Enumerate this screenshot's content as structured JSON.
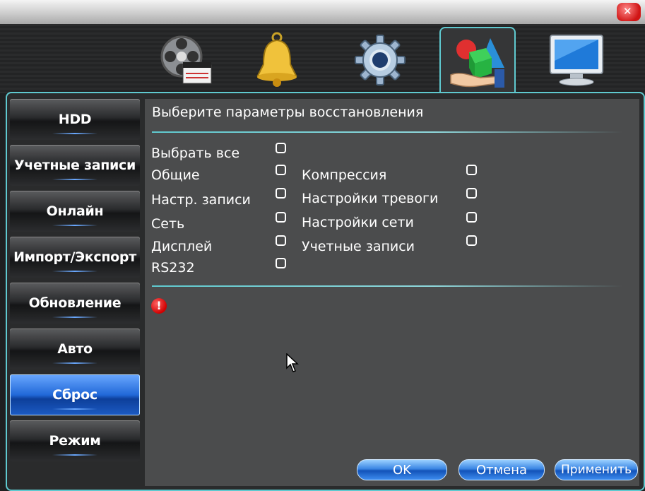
{
  "window": {
    "close_icon": "close-icon"
  },
  "tabs": [
    {
      "icon": "film-reel-icon",
      "active": false
    },
    {
      "icon": "bell-icon",
      "active": false
    },
    {
      "icon": "gear-icon",
      "active": false
    },
    {
      "icon": "shapes-hand-icon",
      "active": true
    },
    {
      "icon": "monitor-icon",
      "active": false
    }
  ],
  "sidebar": {
    "items": [
      {
        "label": "HDD"
      },
      {
        "label": "Учетные записи"
      },
      {
        "label": "Онлайн"
      },
      {
        "label": "Импорт/Экспорт"
      },
      {
        "label": "Обновление"
      },
      {
        "label": "Авто"
      },
      {
        "label": "Сброс",
        "active": true
      },
      {
        "label": "Режим"
      }
    ]
  },
  "main": {
    "heading": "Выберите параметры восстановления",
    "select_all": "Выбрать все",
    "left_options": [
      "Общие",
      "Настр. записи",
      "Сеть",
      "Дисплей",
      "RS232"
    ],
    "right_options": [
      "Компрессия",
      "Настройки тревоги",
      "Настройки сети",
      "Учетные записи"
    ],
    "warning_icon": "warning-icon"
  },
  "buttons": {
    "ok": "OK",
    "cancel": "Отмена",
    "apply": "Применить"
  },
  "colors": {
    "accent": "#5fc9cf",
    "active_button": "#2168d8",
    "panel": "#4b4c4d"
  }
}
